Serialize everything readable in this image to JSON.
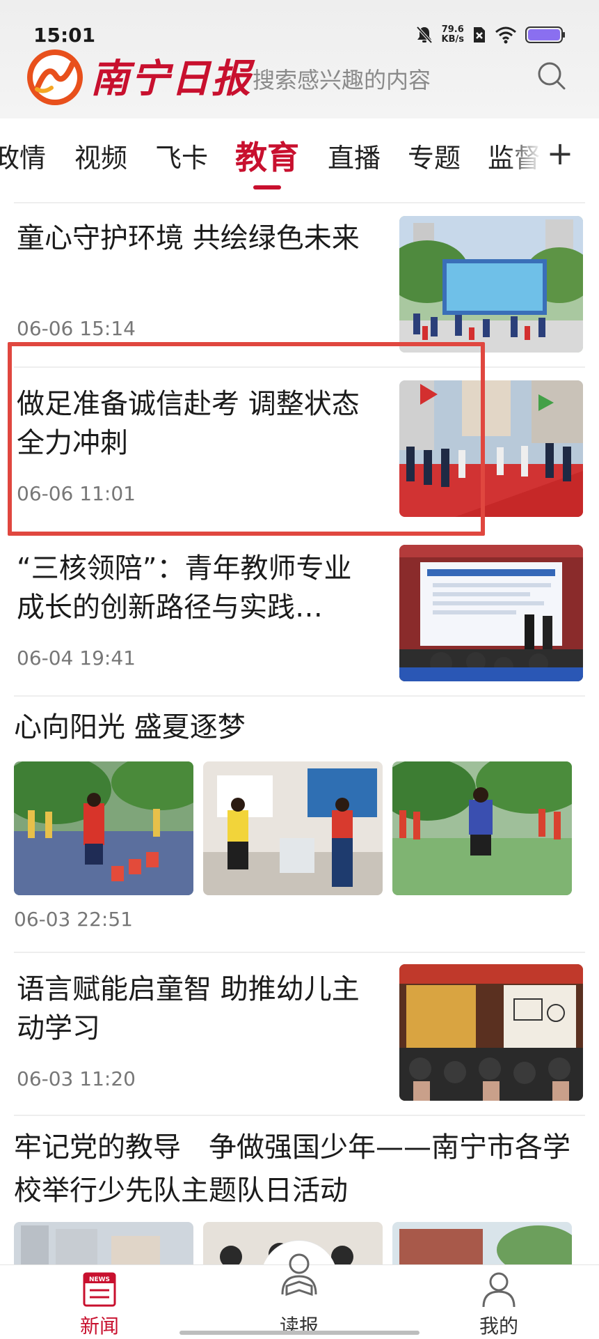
{
  "status_bar": {
    "time": "15:01",
    "net_speed_value": "79.6",
    "net_speed_unit": "KB/s"
  },
  "header": {
    "logo_name": "南宁日报",
    "search_placeholder": "搜索感兴趣的内容"
  },
  "tabs": [
    "政情",
    "视频",
    "飞卡",
    "教育",
    "直播",
    "专题",
    "监督"
  ],
  "active_tab": "教育",
  "articles": [
    {
      "title": "童心守护环境  共绘绿色未来",
      "time": "06-06 15:14"
    },
    {
      "title": "做足准备诚信赴考  调整状态全力冲刺",
      "time": "06-06 11:01"
    },
    {
      "title": "“三核领陪”：青年教师专业成长的创新路径与实践…",
      "time": "06-04 19:41"
    },
    {
      "title": "心向阳光  盛夏逐梦",
      "time": "06-03 22:51"
    },
    {
      "title": "语言赋能启童智  助推幼儿主动学习",
      "time": "06-03 11:20"
    },
    {
      "title": "牢记党的教导　争做强国少年——南宁市各学校举行少先队主题队日活动",
      "time": ""
    }
  ],
  "bottom_nav": [
    {
      "label": "新闻",
      "icon": "news-icon"
    },
    {
      "label": "读报",
      "icon": "reader-icon"
    },
    {
      "label": "我的",
      "icon": "profile-icon"
    }
  ],
  "colors": {
    "brand_red": "#c8102e",
    "highlight_red": "#e0473f"
  }
}
